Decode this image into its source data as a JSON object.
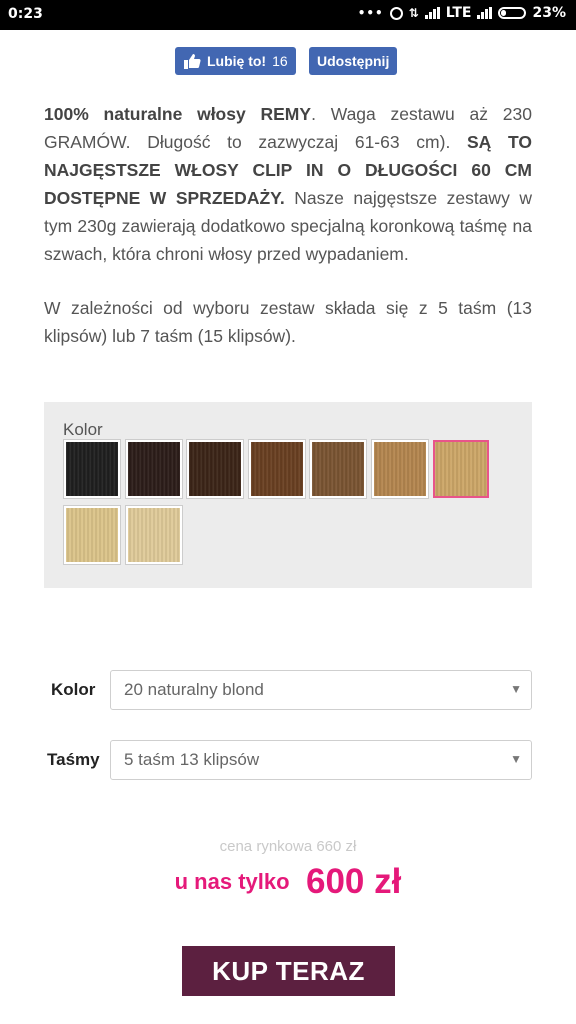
{
  "status_bar": {
    "time": "0:23",
    "network": "LTE",
    "battery": "23%"
  },
  "social": {
    "like_label": "Lubię to!",
    "like_count": "16",
    "share_label": "Udostępnij",
    "color": "#4267b2"
  },
  "description": {
    "p1_bold1": "100% naturalne włosy REMY",
    "p1_text1": ". Waga zestawu aż 230 GRAMÓW. Długość to zazwyczaj 61-63 cm). ",
    "p1_bold2": "SĄ TO NAJGĘSTSZE WŁOSY CLIP IN O DŁUGOŚCI 60 CM DOSTĘPNE W SPRZEDAŻY.",
    "p1_text2": " Nasze najgęstsze zestawy w tym 230g zawierają dodatkowo specjalną koronkową taśmę na szwach, która chroni włosy przed wypadaniem.",
    "p2": "W zależności od wyboru zestaw składa się z 5 taśm (13 klipsów) lub 7 taśm (15 klipsów)."
  },
  "swatch_panel": {
    "title": "Kolor",
    "swatches": [
      {
        "name": "swatch-1",
        "color": "#1c1c1c",
        "selected": false
      },
      {
        "name": "swatch-2",
        "color": "#2a1a16",
        "selected": false
      },
      {
        "name": "swatch-3",
        "color": "#3a2214",
        "selected": false
      },
      {
        "name": "swatch-4",
        "color": "#6a3e1e",
        "selected": false
      },
      {
        "name": "swatch-5",
        "color": "#7c5430",
        "selected": false
      },
      {
        "name": "swatch-6",
        "color": "#b8884e",
        "selected": false
      },
      {
        "name": "swatch-7",
        "color": "#d2aa68",
        "selected": true
      },
      {
        "name": "swatch-8",
        "color": "#e2c98c",
        "selected": false
      },
      {
        "name": "swatch-9",
        "color": "#e6d09c",
        "selected": false
      }
    ]
  },
  "form": {
    "color_label": "Kolor",
    "color_value": "20 naturalny blond",
    "strips_label": "Taśmy",
    "strips_value": "5 taśm 13 klipsów"
  },
  "pricing": {
    "market_price": "cena rynkowa 660 zł",
    "lead": "u nas tylko",
    "price": "600 zł",
    "accent": "#e5197a"
  },
  "buy_button": {
    "label": "KUP TERAZ",
    "color": "#5c2040"
  }
}
